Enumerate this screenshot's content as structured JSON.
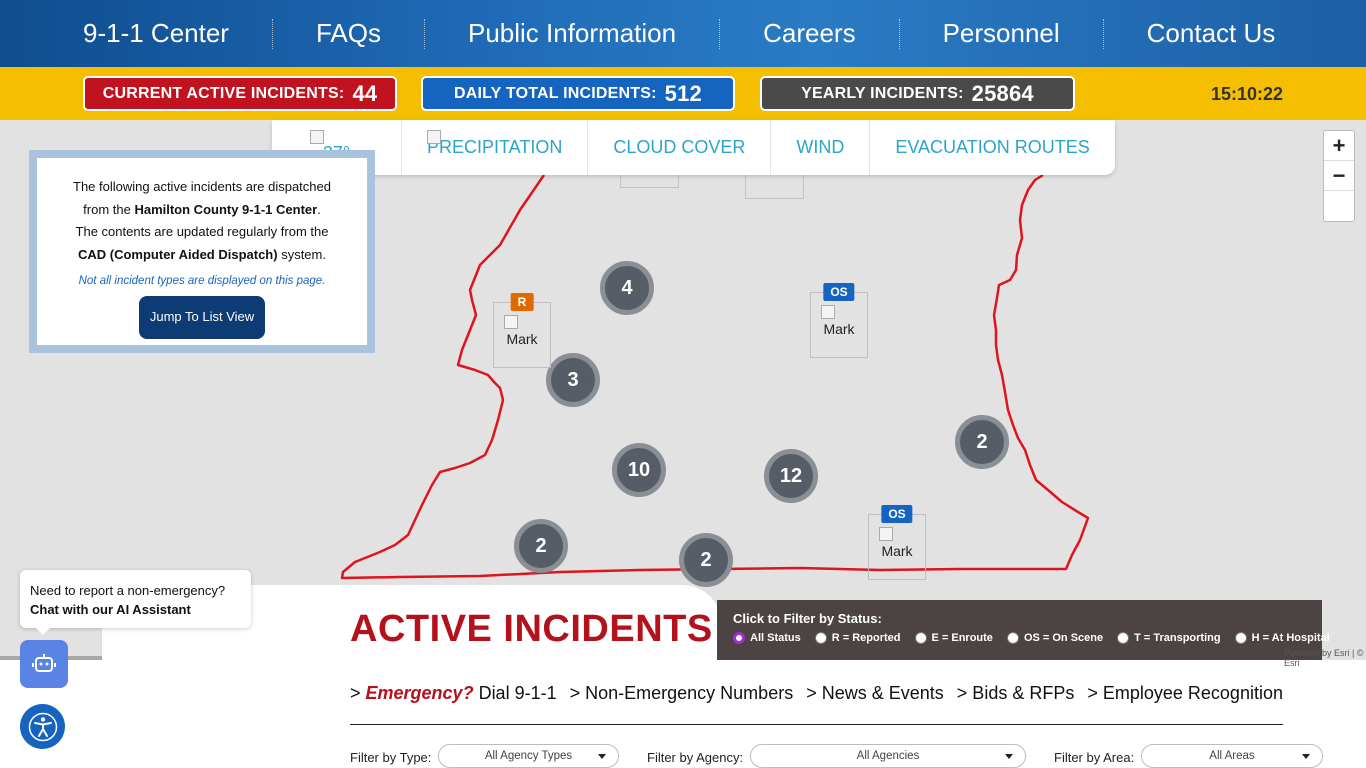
{
  "nav": {
    "items": [
      "9-1-1 Center",
      "FAQs",
      "Public Information",
      "Careers",
      "Personnel",
      "Contact Us"
    ]
  },
  "stats": {
    "active_label": "CURRENT ACTIVE INCIDENTS:",
    "active_value": "44",
    "daily_label": "DAILY TOTAL INCIDENTS:",
    "daily_value": "512",
    "yearly_label": "YEARLY INCIDENTS:",
    "yearly_value": "25864",
    "clock": "15:10:22",
    "colors": {
      "active": "#c1121f",
      "daily": "#1565c0",
      "yearly": "#4a4a4a",
      "bar": "#f6be00"
    }
  },
  "weather": {
    "temp": "27°",
    "tabs": [
      "PRECIPITATION",
      "CLOUD COVER",
      "WIND",
      "EVACUATION ROUTES"
    ]
  },
  "zoom": {
    "in": "+",
    "out": "−"
  },
  "info": {
    "line1": "The following active incidents are dispatched",
    "line2a": "from the ",
    "line2b": "Hamilton County 9-1-1 Center",
    "line2c": ".",
    "line3": "The contents are updated regularly from the",
    "line4a": "CAD (Computer Aided Dispatch)",
    "line4b": " system.",
    "note": "Not all incident types are displayed on this page.",
    "jump": "Jump To List View"
  },
  "map": {
    "clusters": [
      "4",
      "3",
      "10",
      "12",
      "2",
      "2",
      "2"
    ],
    "markers": [
      {
        "badge": "R",
        "label": "Mark"
      },
      {
        "badge": "OS",
        "label": "Mark"
      },
      {
        "badge": "OS",
        "label": "Mark"
      }
    ],
    "boundary_color": "#e0141e",
    "attribution": "Powered by Esri | © Esri"
  },
  "section": {
    "title": "ACTIVE INCIDENTS",
    "filter_title": "Click to Filter by Status:",
    "statuses": [
      "All Status",
      "R = Reported",
      "E = Enroute",
      "OS = On Scene",
      "T = Transporting",
      "H = At Hospital"
    ]
  },
  "links": {
    "emergency_prefix": "> ",
    "emergency": "Emergency?",
    "emergency_suffix": " Dial 9-1-1",
    "items": [
      "> Non-Emergency Numbers",
      "> News & Events",
      "> Bids & RFPs",
      "> Employee Recognition"
    ]
  },
  "filters": {
    "type_label": "Filter by Type:",
    "type_value": "All Agency Types",
    "agency_label": "Filter by Agency:",
    "agency_value": "All Agencies",
    "area_label": "Filter by Area:",
    "area_value": "All Areas"
  },
  "chat": {
    "line1": "Need to report a non-emergency?",
    "line2": "Chat with our AI Assistant"
  },
  "icons": [
    "robot-chat-icon",
    "accessibility-icon",
    "broken-image-icon"
  ]
}
